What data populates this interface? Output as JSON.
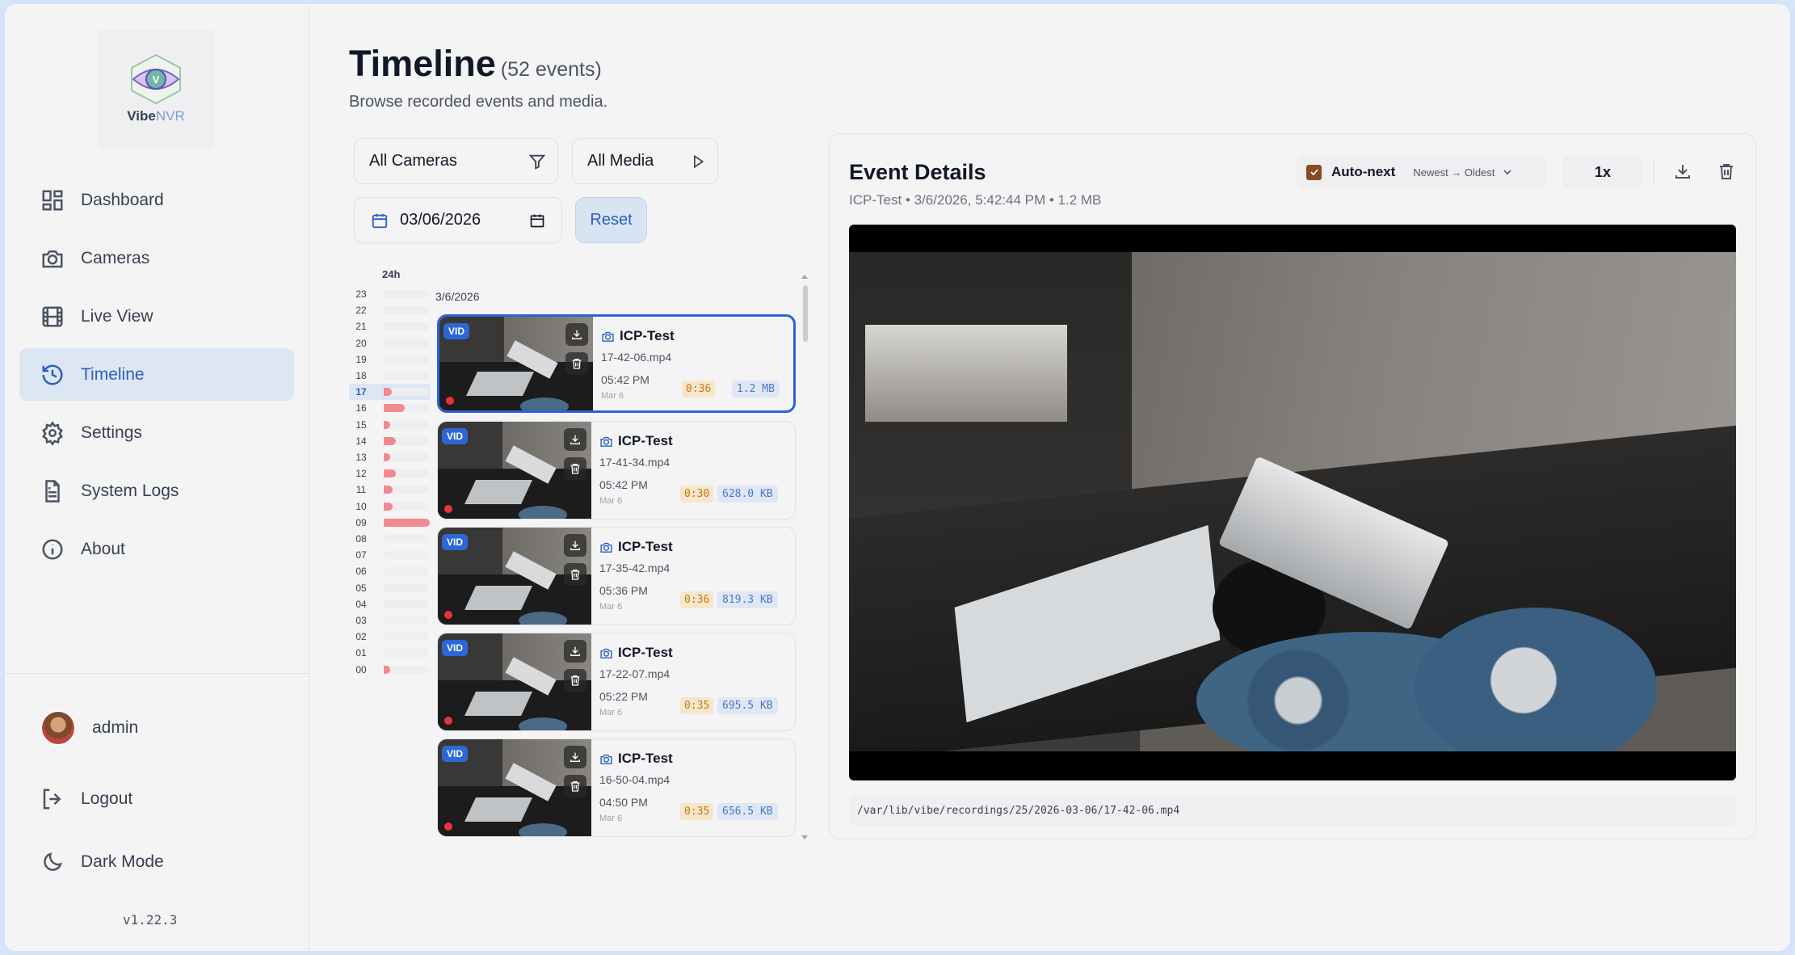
{
  "app": {
    "brand_main": "Vibe",
    "brand_accent": "NVR",
    "version": "v1.22.3"
  },
  "sidebar": {
    "items": [
      {
        "label": "Dashboard",
        "icon": "dashboard-icon"
      },
      {
        "label": "Cameras",
        "icon": "camera-icon"
      },
      {
        "label": "Live View",
        "icon": "film-icon"
      },
      {
        "label": "Timeline",
        "icon": "history-icon",
        "active": true
      },
      {
        "label": "Settings",
        "icon": "gear-icon"
      },
      {
        "label": "System Logs",
        "icon": "file-text-icon"
      },
      {
        "label": "About",
        "icon": "info-icon"
      }
    ],
    "user": "admin",
    "logout": "Logout",
    "dark_mode": "Dark Mode"
  },
  "page": {
    "title": "Timeline",
    "count": "(52 events)",
    "subtitle": "Browse recorded events and media."
  },
  "filters": {
    "camera": "All Cameras",
    "media": "All Media",
    "date": "03/06/2026",
    "reset": "Reset"
  },
  "histogram": {
    "label": "24h",
    "selected_hour": "17",
    "hours": [
      {
        "h": "23",
        "level": 0
      },
      {
        "h": "22",
        "level": 0
      },
      {
        "h": "21",
        "level": 0
      },
      {
        "h": "20",
        "level": 0
      },
      {
        "h": "19",
        "level": 0
      },
      {
        "h": "18",
        "level": 0
      },
      {
        "h": "17",
        "level": 0.18
      },
      {
        "h": "16",
        "level": 0.45
      },
      {
        "h": "15",
        "level": 0.14
      },
      {
        "h": "14",
        "level": 0.27
      },
      {
        "h": "13",
        "level": 0.14
      },
      {
        "h": "12",
        "level": 0.27
      },
      {
        "h": "11",
        "level": 0.2
      },
      {
        "h": "10",
        "level": 0.2
      },
      {
        "h": "09",
        "level": 1.0
      },
      {
        "h": "08",
        "level": 0
      },
      {
        "h": "07",
        "level": 0
      },
      {
        "h": "06",
        "level": 0
      },
      {
        "h": "05",
        "level": 0
      },
      {
        "h": "04",
        "level": 0
      },
      {
        "h": "03",
        "level": 0
      },
      {
        "h": "02",
        "level": 0
      },
      {
        "h": "01",
        "level": 0
      },
      {
        "h": "00",
        "level": 0.14
      }
    ]
  },
  "events": {
    "date_heading": "3/6/2026",
    "badge": "VID",
    "items": [
      {
        "camera": "ICP-Test",
        "file": "17-42-06.mp4",
        "time": "05:42 PM",
        "date": "Mar 6",
        "duration": "0:36",
        "size": "1.2 MB",
        "active": true
      },
      {
        "camera": "ICP-Test",
        "file": "17-41-34.mp4",
        "time": "05:42 PM",
        "date": "Mar 6",
        "duration": "0:30",
        "size": "628.0 KB"
      },
      {
        "camera": "ICP-Test",
        "file": "17-35-42.mp4",
        "time": "05:36 PM",
        "date": "Mar 6",
        "duration": "0:36",
        "size": "819.3 KB"
      },
      {
        "camera": "ICP-Test",
        "file": "17-22-07.mp4",
        "time": "05:22 PM",
        "date": "Mar 6",
        "duration": "0:35",
        "size": "695.5 KB"
      },
      {
        "camera": "ICP-Test",
        "file": "16-50-04.mp4",
        "time": "04:50 PM",
        "date": "Mar 6",
        "duration": "0:35",
        "size": "656.5 KB"
      }
    ]
  },
  "details": {
    "title": "Event Details",
    "meta": "ICP-Test • 3/6/2026, 5:42:44 PM • 1.2 MB",
    "auto_next": "Auto-next",
    "auto_next_checked": true,
    "order": "Newest → Oldest",
    "speed": "1x",
    "path": "/var/lib/vibe/recordings/25/2026-03-06/17-42-06.mp4"
  },
  "colors": {
    "accent": "#2c5ec5",
    "active_border": "#2b63d9",
    "hist_bar": "#ef8a8f",
    "checkbox": "#8a4b22"
  }
}
